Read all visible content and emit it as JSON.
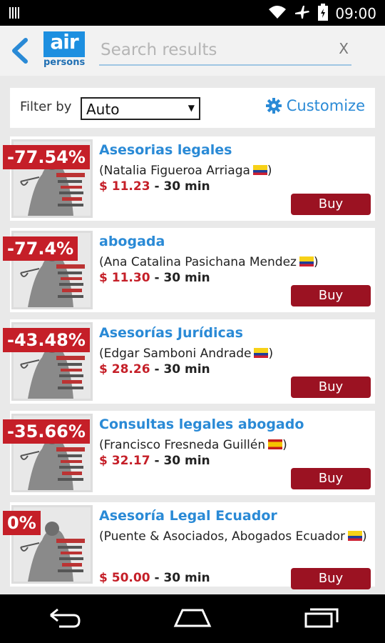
{
  "status_bar": {
    "time": "09:00"
  },
  "header": {
    "logo_top": "air",
    "logo_bottom": "persons",
    "search_placeholder": "Search results",
    "clear_label": "X"
  },
  "filter": {
    "label": "Filter by",
    "selected": "Auto",
    "customize_label": "Customize"
  },
  "results": [
    {
      "discount": "-77.54%",
      "title": "Asesorias legales",
      "provider": "(Natalia Figueroa Arriaga",
      "flag": "colombia-flag-icon",
      "flag_class": "flag-co",
      "price": "$ 11.23",
      "duration": "30 min",
      "buy_label": "Buy"
    },
    {
      "discount": "-77.4%",
      "title": "abogada",
      "provider": "(Ana Catalina Pasichana Mendez",
      "flag": "colombia-flag-icon",
      "flag_class": "flag-co",
      "price": "$ 11.30",
      "duration": "30 min",
      "buy_label": "Buy"
    },
    {
      "discount": "-43.48%",
      "title": "Asesorías Jurídicas",
      "provider": "(Edgar Samboni Andrade",
      "flag": "colombia-flag-icon",
      "flag_class": "flag-co",
      "price": "$ 28.26",
      "duration": "30 min",
      "buy_label": "Buy"
    },
    {
      "discount": "-35.66%",
      "title": "Consultas legales abogado",
      "provider": "(Francisco Fresneda Guillén",
      "flag": "spain-flag-icon",
      "flag_class": "flag-es",
      "price": "$ 32.17",
      "duration": "30 min",
      "buy_label": "Buy"
    },
    {
      "discount": "0%",
      "title": "Asesoría Legal Ecuador",
      "provider": "(Puente & Asociados, Abogados Ecuador",
      "flag": "ecuador-flag-icon",
      "flag_class": "flag-ec",
      "price": "$ 50.00",
      "duration": "30 min",
      "buy_label": "Buy"
    }
  ],
  "colors": {
    "accent_blue": "#2a8ad6",
    "discount_red": "#c51f28",
    "buy_button": "#9b1222"
  }
}
